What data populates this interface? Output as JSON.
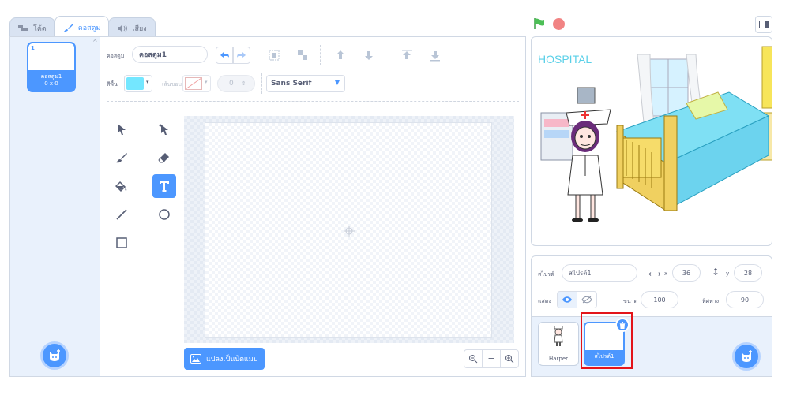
{
  "tabs": [
    {
      "label": "โค้ด",
      "icon": "code-icon"
    },
    {
      "label": "คอสตูม",
      "icon": "brush-icon"
    },
    {
      "label": "เสียง",
      "icon": "speaker-icon"
    }
  ],
  "costumes": [
    {
      "number": "1",
      "name": "คอสตูม1",
      "size": "0 x 0"
    }
  ],
  "editor": {
    "costume_label": "คอสตูม",
    "costume_name": "คอสตูม1",
    "fill_label": "สีพื้น",
    "fill_color": "#74e7ff",
    "outline_label": "เส้นขอบ",
    "outline_width": "0",
    "font": "Sans Serif",
    "convert_label": "แปลงเป็นบิตแมป",
    "zoom_reset": "="
  },
  "stage": {
    "title": "HOSPITAL",
    "green_flag": "#4cbf56",
    "stop_color": "#ec5959"
  },
  "sprite_info": {
    "sprite_label": "สไปรต์",
    "sprite_name": "สไปรต์1",
    "x_label": "x",
    "x_value": "36",
    "y_label": "y",
    "y_value": "28",
    "show_label": "แสดง",
    "size_label": "ขนาด",
    "size_value": "100",
    "direction_label": "ทิศทาง",
    "direction_value": "90"
  },
  "sprites": [
    {
      "name": "Harper"
    },
    {
      "name": "สไปรต์1"
    }
  ],
  "colors": {
    "accent": "#4c97ff",
    "highlight_box": "#e3141a"
  }
}
